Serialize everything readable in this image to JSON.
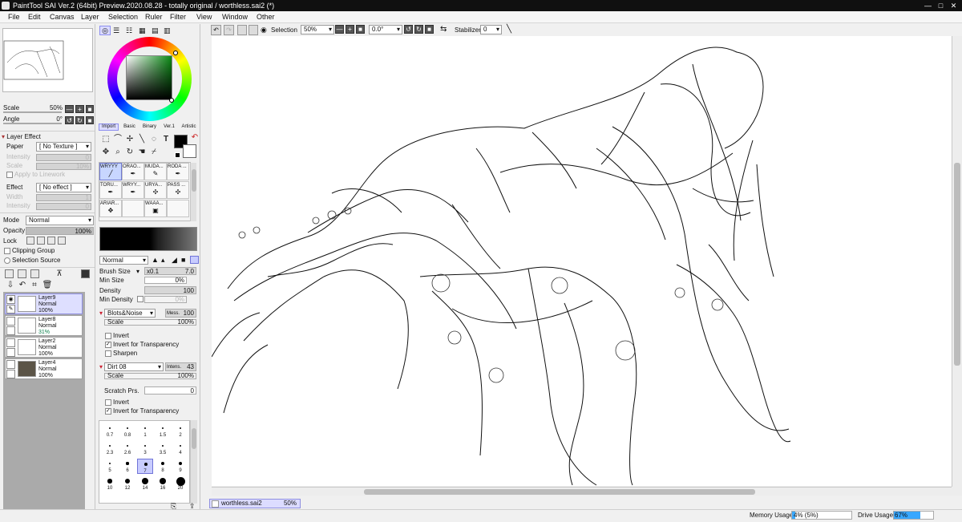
{
  "window": {
    "title": "PaintTool SAI Ver.2 (64bit) Preview.2020.08.28 - totally original / worthless.sai2 (*)"
  },
  "menu": [
    "File",
    "Edit",
    "Canvas",
    "Layer",
    "Selection",
    "Ruler",
    "Filter",
    "View",
    "Window",
    "Other"
  ],
  "navigator": {
    "scale_label": "Scale",
    "scale_value": "50%",
    "angle_label": "Angle",
    "angle_value": "0°"
  },
  "layer_effect": {
    "header": "Layer Effect",
    "paper_label": "Paper",
    "paper_value": "[ No Texture ]",
    "intensity_label": "Intensity",
    "intensity_value": "0",
    "scale_label": "Scale",
    "scale_value": "10%",
    "apply_linework": "Apply to Linework",
    "effect_label": "Effect",
    "effect_value": "[ No effect ]",
    "width_label": "Width",
    "width_value": "1",
    "intensity2_label": "Intensity",
    "intensity2_value": "0"
  },
  "layer_props": {
    "mode_label": "Mode",
    "mode_value": "Normal",
    "opacity_label": "Opacity",
    "opacity_value": "100%",
    "opacity_level": 1.0,
    "lock_label": "Lock",
    "clipping_label": "Clipping Group",
    "selection_source_label": "Selection Source"
  },
  "layers": [
    {
      "name": "Layer9",
      "mode": "Normal",
      "opacity": "100%",
      "active": true
    },
    {
      "name": "Layer8",
      "mode": "Normal",
      "opacity": "31%",
      "active": false
    },
    {
      "name": "Layer2",
      "mode": "Normal",
      "opacity": "100%",
      "active": false
    },
    {
      "name": "Layer4",
      "mode": "Normal",
      "opacity": "100%",
      "active": false
    }
  ],
  "color_tabs": [
    "Import",
    "Basic",
    "Binary",
    "Ver.1",
    "Artistic"
  ],
  "brushes": [
    {
      "name": "WRYYY",
      "active": true
    },
    {
      "name": "ORAO...",
      "active": false
    },
    {
      "name": "MUDA...",
      "active": false
    },
    {
      "name": "RODA ...",
      "active": false
    },
    {
      "name": "TORU...",
      "active": false
    },
    {
      "name": "WRYY...",
      "active": false
    },
    {
      "name": "URYA...",
      "active": false
    },
    {
      "name": "PASS ...",
      "active": false
    },
    {
      "name": "ARIAR...",
      "active": false
    },
    {
      "name": "",
      "active": false
    },
    {
      "name": "WAAA...",
      "active": false
    },
    {
      "name": "",
      "active": false
    }
  ],
  "brush_settings": {
    "blend_mode": "Normal",
    "brush_size_label": "Brush Size",
    "brush_size_mult": "x0.1",
    "brush_size_value": "7.0",
    "min_size_label": "Min Size",
    "min_size_value": "0%",
    "density_label": "Density",
    "density_value": "100",
    "min_density_label": "Min Density",
    "min_density_value": "0%",
    "texture1_name": "Blots&Noise",
    "texture1_param": "Mess.",
    "texture1_value": "100",
    "texture1_scale_label": "Scale",
    "texture1_scale_value": "100%",
    "invert_label": "Invert",
    "invert_transparency_label": "Invert for Transparency",
    "sharpen_label": "Sharpen",
    "texture2_name": "Dirt 08",
    "texture2_param": "Intens.",
    "texture2_value": "43",
    "texture2_scale_label": "Scale",
    "texture2_scale_value": "100%",
    "scratch_label": "Scratch Prs.",
    "scratch_value": "0",
    "invert2_label": "Invert",
    "invert_transparency2_label": "Invert for Transparency"
  },
  "dot_sizes": [
    "0.7",
    "0.8",
    "1",
    "1.5",
    "2",
    "2.3",
    "2.6",
    "3",
    "3.5",
    "4",
    "5",
    "6",
    "7",
    "8",
    "9",
    "10",
    "12",
    "14",
    "16",
    "20"
  ],
  "dot_selected": "7",
  "toolbar": {
    "selection_label": "Selection",
    "zoom_value": "50%",
    "rotation_value": "0.0°",
    "stabilizer_label": "Stabilizer",
    "stabilizer_value": "0"
  },
  "document_tab": {
    "name": "worthless.sai2",
    "zoom": "50%"
  },
  "status": {
    "memory_label": "Memory Usage",
    "memory_value": "4% (5%)",
    "memory_level": 0.05,
    "drive_label": "Drive Usage",
    "drive_value": "67%",
    "drive_level": 0.67
  },
  "colors": {
    "accent": "#8f8fe0",
    "drive_fill": "#38a7ff",
    "titlebar": "#101010"
  }
}
